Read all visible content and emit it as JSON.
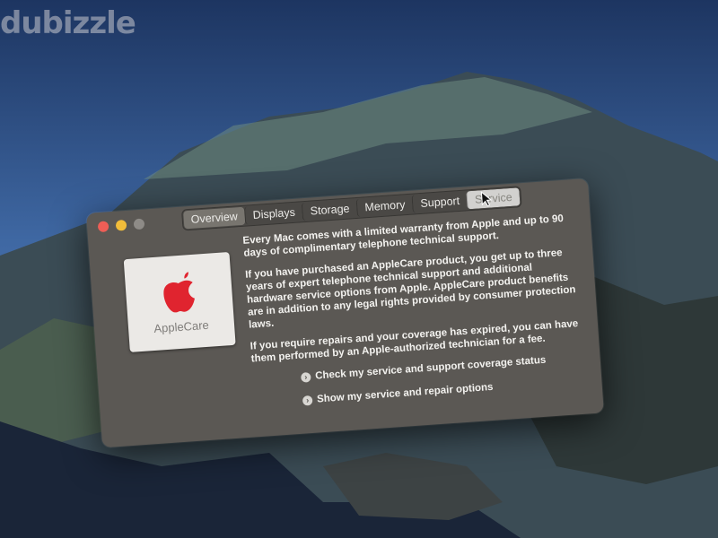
{
  "watermark": "dubizzle",
  "window": {
    "tabs": [
      "Overview",
      "Displays",
      "Storage",
      "Memory",
      "Support",
      "Service"
    ],
    "selected_tab": "Overview",
    "active_tab": "Service"
  },
  "applecare": {
    "label": "AppleCare"
  },
  "content": {
    "paragraphs": [
      "Every Mac comes with a limited warranty from Apple and up to 90 days of complimentary telephone technical support.",
      "If you have purchased an AppleCare product, you get up to three years of expert telephone technical support and additional hardware service options from Apple. AppleCare product benefits are in addition to any legal rights provided by consumer protection laws.",
      "If you require repairs and your coverage has expired, you can have them performed by an Apple-authorized technician for a fee."
    ],
    "links": [
      "Check my service and support coverage status",
      "Show my service and repair options"
    ]
  }
}
